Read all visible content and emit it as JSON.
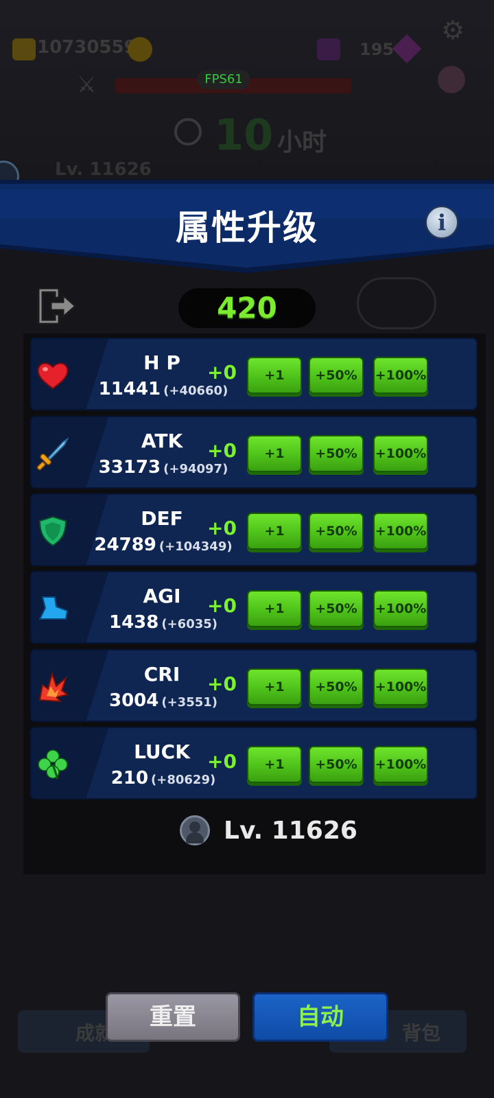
{
  "background_hud": {
    "coins": "10730559",
    "gems": "195",
    "fps": "FPS61",
    "timer_value": "10",
    "timer_unit": "小时",
    "level_text": "Lv. 11626",
    "bottom_left": "成就",
    "bottom_right": "背包"
  },
  "header": {
    "title": "属性升级",
    "info_label": "i"
  },
  "points": "420",
  "buttons": {
    "plus1": "+1",
    "plus50": "+50%",
    "plus100": "+100%"
  },
  "stats": [
    {
      "name": "H P",
      "base": "11441",
      "bonus": "(+40660)",
      "added": "+0",
      "icon": "heart-icon"
    },
    {
      "name": "ATK",
      "base": "33173",
      "bonus": "(+94097)",
      "added": "+0",
      "icon": "sword-icon"
    },
    {
      "name": "DEF",
      "base": "24789",
      "bonus": "(+104349)",
      "added": "+0",
      "icon": "shield-icon"
    },
    {
      "name": "AGI",
      "base": "1438",
      "bonus": "(+6035)",
      "added": "+0",
      "icon": "boot-icon"
    },
    {
      "name": "CRI",
      "base": "3004",
      "bonus": "(+3551)",
      "added": "+0",
      "icon": "critical-burst-icon"
    },
    {
      "name": "LUCK",
      "base": "210",
      "bonus": "(+80629)",
      "added": "+0",
      "icon": "clover-icon"
    }
  ],
  "player": {
    "level": "Lv. 11626"
  },
  "footer": {
    "reset_label": "重置",
    "auto_label": "自动"
  },
  "colors": {
    "accent_green": "#7dec2e",
    "button_green": "#4fc21a",
    "row_blue": "#0f2552",
    "auto_blue": "#1b63c8"
  }
}
